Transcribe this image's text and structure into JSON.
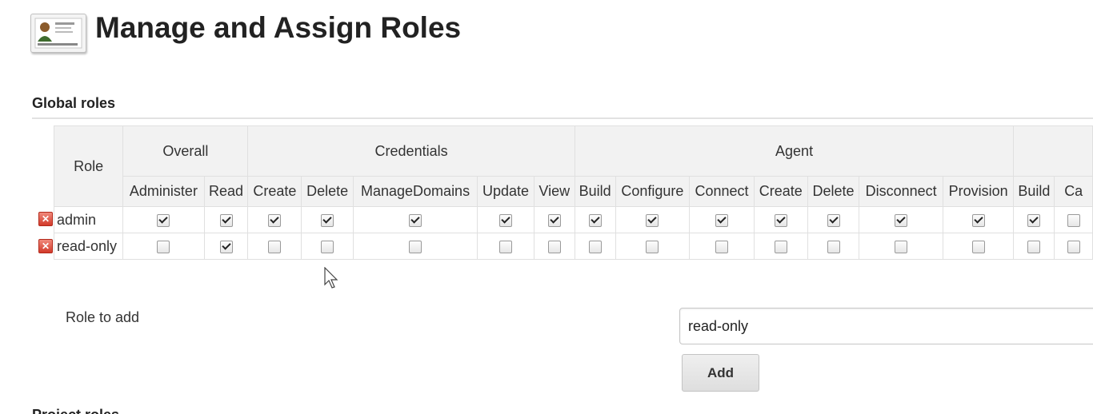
{
  "header": {
    "title": "Manage and Assign Roles",
    "icon": "roles-id-card-icon"
  },
  "global_roles": {
    "section_title": "Global roles",
    "role_column_label": "Role",
    "groups": [
      "Overall",
      "Credentials",
      "Agent",
      ""
    ],
    "permissions": [
      "Administer",
      "Read",
      "Create",
      "Delete",
      "ManageDomains",
      "Update",
      "View",
      "Build",
      "Configure",
      "Connect",
      "Create",
      "Delete",
      "Disconnect",
      "Provision",
      "Build",
      "Ca"
    ],
    "rows": [
      {
        "name": "admin",
        "checks": [
          true,
          true,
          true,
          true,
          true,
          true,
          true,
          true,
          true,
          true,
          true,
          true,
          true,
          true,
          true,
          false
        ]
      },
      {
        "name": "read-only",
        "checks": [
          false,
          true,
          false,
          false,
          false,
          false,
          false,
          false,
          false,
          false,
          false,
          false,
          false,
          false,
          false,
          false
        ]
      }
    ]
  },
  "add_role": {
    "label": "Role to add",
    "value": "read-only",
    "button_label": "Add"
  },
  "next_section_title": "Project roles",
  "colors": {
    "header_bg": "#f2f2f2",
    "border": "#e0e0e0",
    "delete_icon": "#d23a2a"
  }
}
